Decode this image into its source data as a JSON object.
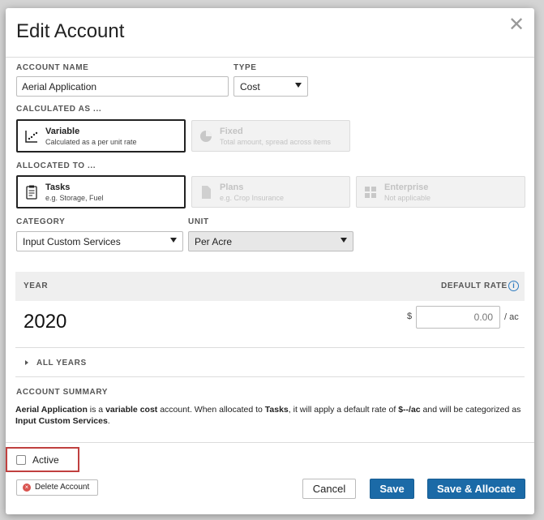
{
  "dialog": {
    "title": "Edit Account",
    "close_glyph": "✕"
  },
  "account_name": {
    "label": "ACCOUNT NAME",
    "value": "Aerial Application"
  },
  "type": {
    "label": "TYPE",
    "selected": "Cost"
  },
  "calculated_as": {
    "label": "CALCULATED AS ...",
    "options": [
      {
        "title": "Variable",
        "subtitle": "Calculated as a per unit rate",
        "selected": true,
        "icon": "scatter-chart-icon"
      },
      {
        "title": "Fixed",
        "subtitle": "Total amount, spread across items",
        "selected": false,
        "icon": "pie-chart-icon"
      }
    ]
  },
  "allocated_to": {
    "label": "ALLOCATED TO ...",
    "options": [
      {
        "title": "Tasks",
        "subtitle": "e.g. Storage, Fuel",
        "selected": true,
        "icon": "clipboard-icon"
      },
      {
        "title": "Plans",
        "subtitle": "e.g. Crop Insurance",
        "selected": false,
        "icon": "document-icon"
      },
      {
        "title": "Enterprise",
        "subtitle": "Not applicable",
        "selected": false,
        "icon": "grid-icon"
      }
    ]
  },
  "category": {
    "label": "CATEGORY",
    "selected": "Input Custom Services"
  },
  "unit": {
    "label": "UNIT",
    "selected": "Per Acre"
  },
  "rates": {
    "year_header": "YEAR",
    "rate_header": "DEFAULT RATE",
    "year": "2020",
    "currency": "$",
    "rate_value": "0.00",
    "rate_unit": "/ ac",
    "all_years_label": "ALL YEARS"
  },
  "summary": {
    "heading": "ACCOUNT SUMMARY",
    "name": "Aerial Application",
    "text_1": " is a ",
    "cost_type": "variable cost",
    "text_2": " account. When allocated to ",
    "alloc": "Tasks",
    "text_3": ", it will apply a default rate of ",
    "rate": "$--/ac",
    "text_4": " and will be categorized as ",
    "category": "Input Custom Services",
    "text_5": "."
  },
  "footer": {
    "active_label": "Active",
    "delete_label": "Delete Account",
    "cancel_label": "Cancel",
    "save_label": "Save",
    "save_allocate_label": "Save & Allocate"
  },
  "colors": {
    "primary": "#1b6aa7",
    "highlight_border": "#c0403f",
    "info": "#2e7bbf"
  }
}
